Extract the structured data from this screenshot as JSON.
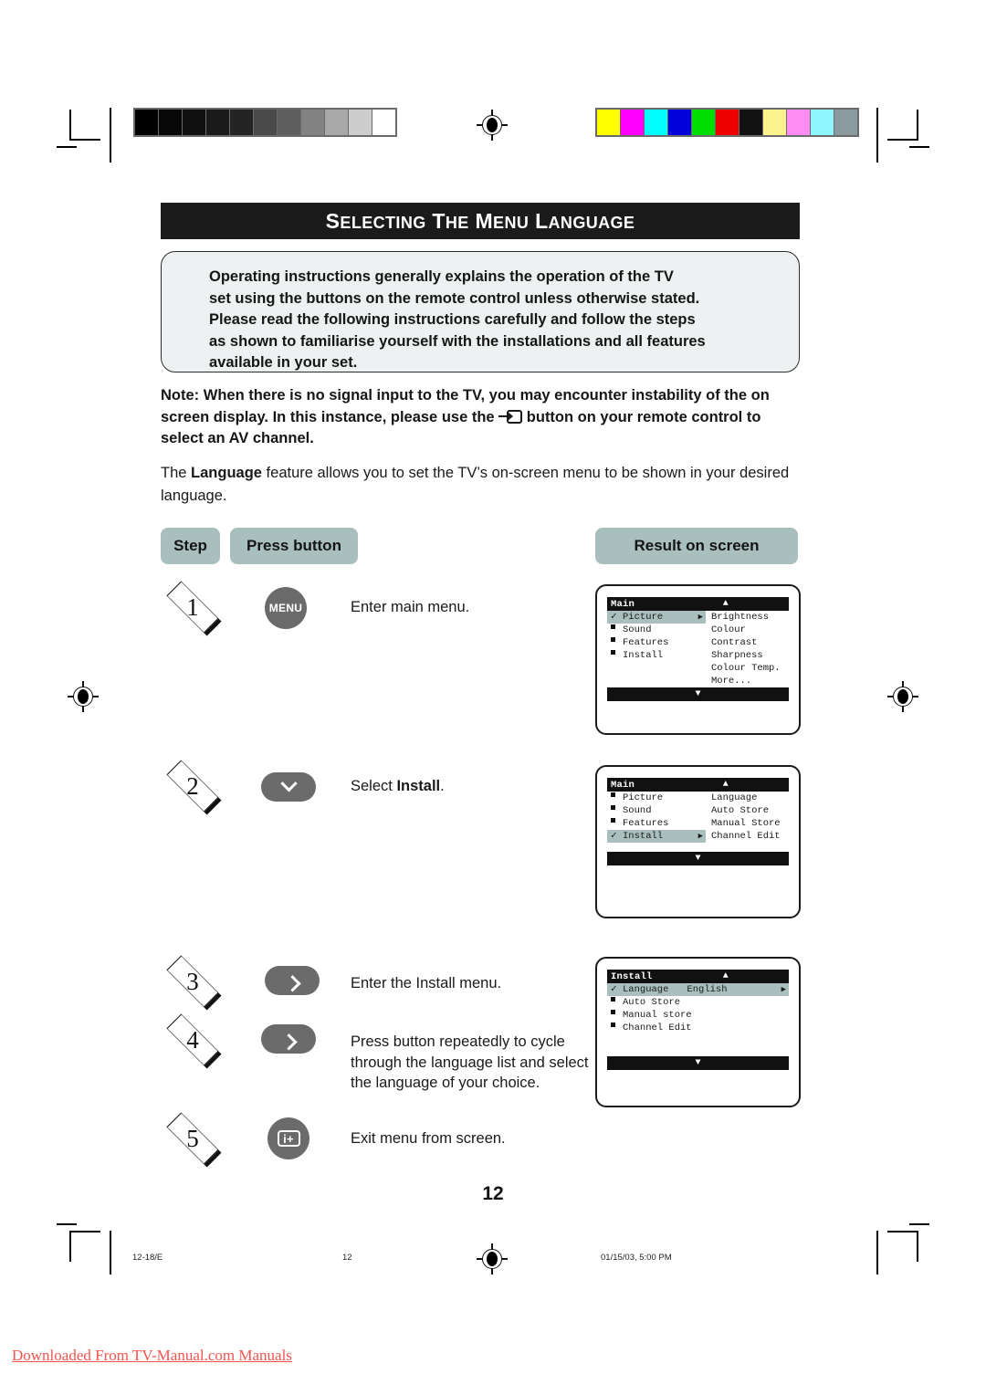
{
  "title": "SELECTING THE MENU LANGUAGE",
  "intro": {
    "line1": "Operating instructions generally explains the operation of the TV",
    "line2": "set using the buttons on the remote control unless otherwise stated.",
    "line3": "Please read the following instructions carefully and follow the steps",
    "line4": "as shown to familiarise yourself with the installations and all features",
    "line5": "available in your set."
  },
  "note": {
    "part1": "Note: When there is no signal input to the TV, you may encounter instability of the on screen display. In this instance, please use the",
    "part2": "button on your remote control to select an AV channel."
  },
  "lead": {
    "pre": "The ",
    "bold": "Language",
    "post": " feature allows you to set the TV’s on-screen menu to be shown in your desired language."
  },
  "table_headers": {
    "step": "Step",
    "press_button": "Press button",
    "result_on_screen": "Result on screen"
  },
  "steps": [
    {
      "num": "1",
      "button_label": "MENU",
      "button_icon": "menu-button",
      "text": "Enter main menu."
    },
    {
      "num": "2",
      "button_label": "",
      "button_icon": "chevron-down-icon",
      "text_pre": "Select ",
      "text_bold": "Install",
      "text_post": "."
    },
    {
      "num": "3",
      "button_label": "",
      "button_icon": "chevron-right-icon",
      "text": "Enter the Install menu."
    },
    {
      "num": "4",
      "button_label": "",
      "button_icon": "chevron-right-icon",
      "text": "Press button repeatedly to cycle through the language list and select the language of your choice."
    },
    {
      "num": "5",
      "button_label": "",
      "button_icon": "info-plus-icon",
      "text": "Exit menu from screen."
    }
  ],
  "screens": [
    {
      "id": "main-picture",
      "title": "Main",
      "up_arrow": "▲",
      "down_arrow": "▼",
      "left_items": [
        {
          "label": "Picture",
          "selected": true,
          "mark": "check",
          "arrow": "▶"
        },
        {
          "label": "Sound",
          "selected": false,
          "mark": "square"
        },
        {
          "label": "Features",
          "selected": false,
          "mark": "square"
        },
        {
          "label": "Install",
          "selected": false,
          "mark": "square"
        }
      ],
      "right_items": [
        {
          "label": "Brightness"
        },
        {
          "label": "Colour"
        },
        {
          "label": "Contrast"
        },
        {
          "label": "Sharpness"
        },
        {
          "label": "Colour Temp."
        },
        {
          "label": "More..."
        }
      ]
    },
    {
      "id": "main-install",
      "title": "Main",
      "up_arrow": "▲",
      "down_arrow": "▼",
      "left_items": [
        {
          "label": "Picture",
          "selected": false,
          "mark": "square"
        },
        {
          "label": "Sound",
          "selected": false,
          "mark": "square"
        },
        {
          "label": "Features",
          "selected": false,
          "mark": "square"
        },
        {
          "label": "Install",
          "selected": true,
          "mark": "check",
          "arrow": "▶"
        }
      ],
      "right_items": [
        {
          "label": "Language"
        },
        {
          "label": "Auto Store"
        },
        {
          "label": "Manual Store"
        },
        {
          "label": "Channel Edit"
        }
      ]
    },
    {
      "id": "install-language",
      "title": "Install",
      "up_arrow": "▲",
      "down_arrow": "▼",
      "rows": [
        {
          "label": "Language",
          "value": "English",
          "selected": true,
          "mark": "check",
          "arrow": "▶"
        },
        {
          "label": "Auto Store",
          "value": "",
          "selected": false,
          "mark": "square"
        },
        {
          "label": "Manual store",
          "value": "",
          "selected": false,
          "mark": "square"
        },
        {
          "label": "Channel Edit",
          "value": "",
          "selected": false,
          "mark": "square"
        }
      ]
    }
  ],
  "page_number": "12",
  "footer": {
    "left": "12-18/E",
    "center": "12",
    "right": "01/15/03, 5:00 PM"
  },
  "watermark": "Downloaded From TV-Manual.com Manuals",
  "colors": {
    "accent_pill": "#a9bfbe",
    "title_bar": "#1b1b1b",
    "button_gray": "#6b6b6b",
    "intro_bg": "#eef1f1",
    "watermark": "#f4544f"
  },
  "calibration": {
    "grayscale": [
      "#000000",
      "#070707",
      "#101010",
      "#1a1a1a",
      "#242424",
      "#4a4a4a",
      "#5e5e5e",
      "#828282",
      "#a8a8a8",
      "#cdcdcd",
      "#ffffff"
    ],
    "colorbar": [
      "#ffff00",
      "#ff00ff",
      "#00ffff",
      "#0000d8",
      "#00dd00",
      "#ee0000",
      "#121212",
      "#fbf28e",
      "#ff8cf2",
      "#8ff6ff",
      "#8b9a9e"
    ]
  }
}
